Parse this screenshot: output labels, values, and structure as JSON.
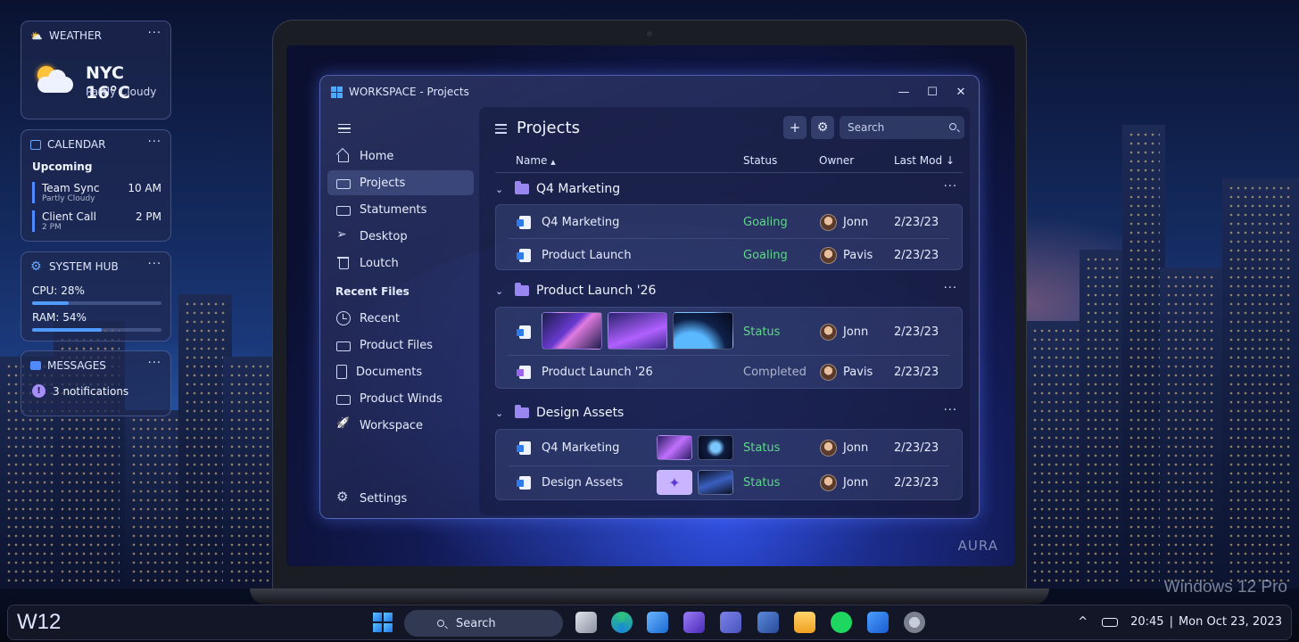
{
  "desktop": {
    "watermark": "Windows 12 Pro"
  },
  "widgets": {
    "weather": {
      "title": "WEATHER",
      "more": "···",
      "temp": "NYC 16°C",
      "condition": "Partly Cloudy"
    },
    "calendar": {
      "title": "CALENDAR",
      "more": "···",
      "section": "Upcoming",
      "events": [
        {
          "title": "Team Sync",
          "sub": "Partly Cloudy",
          "time": "10 AM"
        },
        {
          "title": "Client Call",
          "sub": "2 PM",
          "time": "2 PM"
        }
      ]
    },
    "system": {
      "title": "SYSTEM HUB",
      "more": "···",
      "cpu_label": "CPU: 28%",
      "cpu_value": 28,
      "ram_label": "RAM: 54%",
      "ram_value": 54
    },
    "messages": {
      "title": "MESSAGES",
      "more": "···",
      "notice": "3 notifications"
    }
  },
  "laptop": {
    "brand": "AURA"
  },
  "window": {
    "title": "WORKSPACE - Projects",
    "controls": {
      "minimize": "—",
      "maximize": "☐",
      "close": "✕"
    }
  },
  "nav": {
    "items": [
      {
        "label": "Home",
        "icon": "home-icon"
      },
      {
        "label": "Projects",
        "icon": "folder-icon",
        "active": true
      },
      {
        "label": "Statuments",
        "icon": "folder-icon"
      },
      {
        "label": "Desktop",
        "icon": "send-icon"
      },
      {
        "label": "Loutch",
        "icon": "trash-icon"
      }
    ],
    "recent_heading": "Recent Files",
    "recent_items": [
      {
        "label": "Recent",
        "icon": "clock-icon"
      },
      {
        "label": "Product Files",
        "icon": "folder-icon"
      },
      {
        "label": "Documents",
        "icon": "document-icon"
      },
      {
        "label": "Product Winds",
        "icon": "folder-icon"
      },
      {
        "label": "Workspace",
        "icon": "rocket-icon"
      }
    ],
    "settings": "Settings"
  },
  "main": {
    "title": "Projects",
    "search_placeholder": "Search",
    "add_label": "+",
    "columns": {
      "name": "Name",
      "name_sort": "▲",
      "status": "Status",
      "owner": "Owner",
      "last_mod": "Last Mod",
      "last_mod_sort": "↓"
    },
    "groups": [
      {
        "name": "Q4 Marketing",
        "rows": [
          {
            "name": "Q4 Marketing",
            "status": "Goaling",
            "owner": "Jonn",
            "date": "2/23/23"
          },
          {
            "name": "Product Launch",
            "status": "Goaling",
            "owner": "Pavis",
            "date": "2/23/23"
          }
        ]
      },
      {
        "name": "Product Launch '26",
        "rows": [
          {
            "name": "",
            "status": "Status",
            "owner": "Jonn",
            "date": "2/23/23"
          },
          {
            "name": "Product Launch '26",
            "status": "Completed",
            "owner": "Pavis",
            "date": "2/23/23"
          }
        ]
      },
      {
        "name": "Design Assets",
        "rows": [
          {
            "name": "Q4 Marketing",
            "status": "Status",
            "owner": "Jonn",
            "date": "2/23/23"
          },
          {
            "name": "Design Assets",
            "status": "Status",
            "owner": "Jonn",
            "date": "2/23/23"
          }
        ]
      }
    ],
    "more": "···"
  },
  "taskbar": {
    "logo": "W12",
    "search_label": "Search",
    "time": "20:45",
    "separator": "|",
    "date": "Mon Oct 23, 2023",
    "chevron": "^"
  },
  "colors": {
    "accent": "#4f9bff",
    "status_green": "#5ed88a",
    "folder": "#9a86f0"
  }
}
